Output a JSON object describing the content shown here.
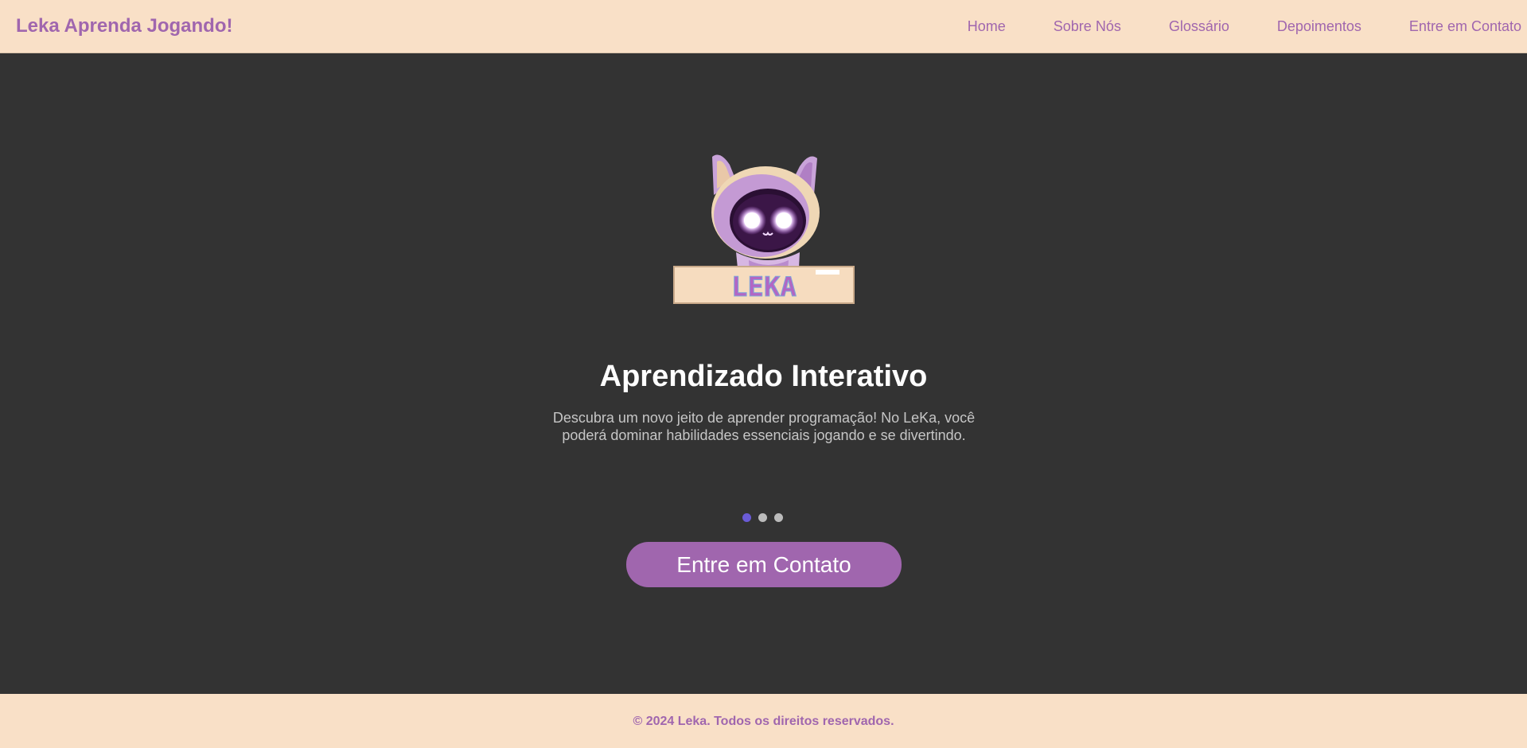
{
  "header": {
    "brand": "Leka Aprenda Jogando!",
    "nav": [
      "Home",
      "Sobre Nós",
      "Glossário",
      "Depoimentos",
      "Entre em Contato"
    ]
  },
  "hero": {
    "logo_text": "LEKA",
    "title": "Aprendizado Interativo",
    "description": "Descubra um novo jeito de aprender programação! No LeKa, você poderá dominar habilidades essenciais jogando e se divertindo.",
    "carousel": {
      "slides": 3,
      "active_index": 0
    },
    "cta_label": "Entre em Contato"
  },
  "footer": {
    "text": "© 2024 Leka. Todos os direitos reservados."
  },
  "colors": {
    "accent": "#a066ae",
    "header_bg": "#f9e0c7",
    "main_bg": "#333333",
    "active_dot": "#6a5bd6"
  }
}
